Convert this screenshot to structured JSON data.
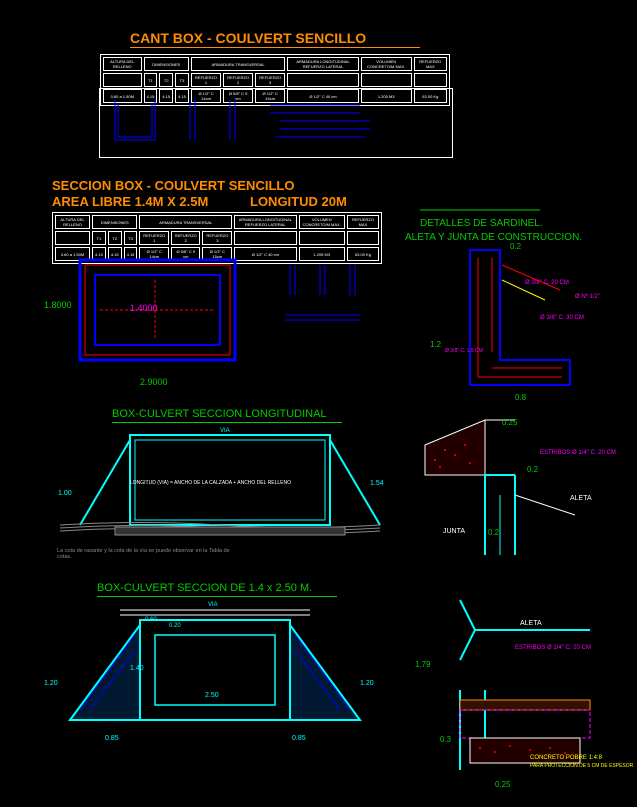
{
  "titles": {
    "main": "CANT BOX - COULVERT SENCILLO",
    "section": "SECCION BOX - COULVERT SENCILLO",
    "area": "AREA LIBRE 1.4M X 2.5M",
    "longitud": "LONGITUD  20M",
    "sardinel": "DETALLES DE SARDINEL.",
    "aleta": "ALETA Y JUNTA DE CONSTRUCCION.",
    "longitudinal": "BOX-CULVERT SECCION LONGITUDINAL",
    "seccion1425": "BOX-CULVERT SECCION DE 1.4 x 2.50 M."
  },
  "table1": {
    "headers": [
      "ALTURA DEL RELLENO",
      "DIMENSIONES",
      "ARMADURA TRANSVERSAL",
      "ARMADURA LONGITUDINAL REFUERZO LATERAL",
      "VOLUMEN CONCRETO/M MAX.",
      "REFUERZO MAX"
    ],
    "subheaders": [
      "",
      "T1",
      "T2",
      "T3",
      "REFUERZO 1",
      "REFUERZO 2",
      "REFUERZO 3",
      "",
      "",
      ""
    ],
    "row": [
      "0.60 a 1.50M",
      "4.15",
      "4.15",
      "4.15",
      "Ø 1/2\" C 14cm",
      "Ø 5/8\" C 9 cm",
      "Ø 1/2\" C 15cm",
      "Ø 1/2\" C 40 cm",
      "1.205 M3",
      "63.00 Kg"
    ]
  },
  "dims": {
    "h18": "1.8000",
    "w29": "2.9000",
    "w14": "1.4000",
    "d02": "0.2",
    "d08": "0.8",
    "d025": "0.25",
    "d03": "0.3",
    "d12": "1.2",
    "d179": "1.79",
    "d100": "1.00",
    "d154": "1.54",
    "d140": "1.40",
    "d250": "2.50",
    "d120": "1.20",
    "d060": "0.60",
    "d020": "0.20",
    "d085": "0.85"
  },
  "labels": {
    "via": "VIA",
    "aleta_lbl": "ALETA",
    "junta": "JUNTA",
    "rebar1": "Ø 3/8\" C. 20 CM",
    "rebar2": "Ø Nº 1/2\"",
    "rebar3": "Ø 3/8\" C. 30 CM",
    "rebar4": "Ø 3/8\" C. 1.5 CM",
    "estribos": "ESTRIBOS Ø 1/4\" C. 20 CM",
    "estribos2": "ESTRIBOS Ø 1/4\" C. 20 CM",
    "concreto": "CONCRETO POBRE 1:4:8",
    "proteccion": "PARA PROTECCION DE 5 CM DE ESPESOR",
    "longitud_note": "LONGITUD (VIA) = ANCHO DE LA CALZADA + ANCHO DEL RELLENO",
    "cota_note": "La cota de rasante y la cota de la vía se puede observar en la Tabla de cotas."
  }
}
